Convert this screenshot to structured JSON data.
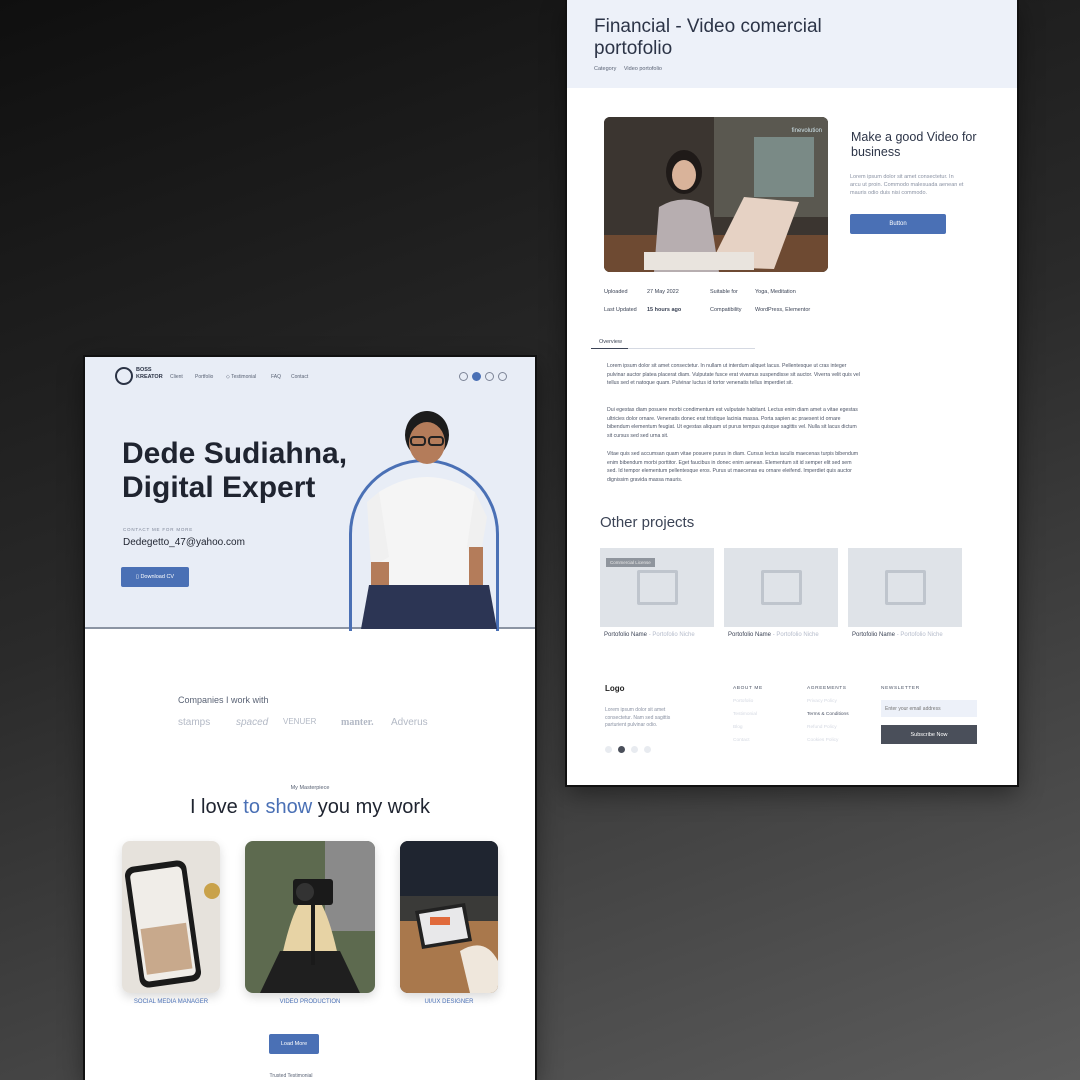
{
  "detail_page": {
    "title": "Financial - Video comercial portofolio",
    "breadcrumb": [
      "Category",
      "Video portofolio"
    ],
    "hero_brand": "finevolution",
    "side_title": "Make a good Video for business",
    "side_text": "Lorem ipsum dolor sit amet consectetur. In arcu ut proin. Commodo malesuada aenean et mauris odio duis nisi commodo.",
    "side_button": "Button",
    "meta": {
      "uploaded_label": "Uploaded",
      "uploaded_value": "27 May 2022",
      "suitable_label": "Suitable for",
      "suitable_value": "Yoga, Meditation",
      "updated_label": "Last Updated",
      "updated_value": "15 hours ago",
      "compat_label": "Compatibility",
      "compat_value": "WordPress, Elementor"
    },
    "tab": "Overview",
    "paragraphs": [
      "Lorem ipsum dolor sit amet consectetur. In nullam ut interdum aliquet lacus. Pellentesque ut cras integer pulvinar auctor platea placerat diam. Vulputate fusce erat vivamus suspendisse sit auctor. Viverra velit quis vel tellus sed et natoque quam. Pulvinar luctus id tortor venenatis tellus imperdiet sit.",
      "Dui egestas diam posuere morbi condimentum est vulputate habitant. Lectus enim diam amet a vitae egestas ultricies dolor ornare. Venenatis donec erat tristique lacinia massa. Porta sapien ac praesent id ornare bibendum elementum feugiat. Ut egestas aliquam ut purus tempus quisque sagittis vel. Nulla sit lacus dictum sit cursus sed sed urna sit.",
      "Vitae quis sed accumsan quam vitae posuere purus in diam. Cursus lectus iaculis maecenas turpis bibendum enim bibendum morbi porttitor. Eget faucibus in donec enim aenean. Elementum sit id semper elit sed sem sed. Id tempor elementum pellentesque eros. Purus ut maecenas eu ornare eleifend. Imperdiet quis auctor dignissim gravida massa mauris."
    ],
    "other_title": "Other projects",
    "card_tag": "Commercial License",
    "projects": [
      {
        "name": "Portofolio Name",
        "niche": "- Portofolio Niche"
      },
      {
        "name": "Portofolio Name",
        "niche": "- Portofolio Niche"
      },
      {
        "name": "Portofolio Name",
        "niche": "- Portofolio Niche"
      }
    ],
    "footer": {
      "logo": "Logo",
      "desc": "Lorem ipsum dolor sit amet consectetur. Nam sed sagittis parturient pulvinar odio.",
      "about_head": "ABOUT ME",
      "about_links": [
        "Portofolio",
        "Testimonial",
        "Blog",
        "Contact"
      ],
      "agreements_head": "AGREEMENTS",
      "agreement_links": [
        "Privacy Policy",
        "Terms & Conditions",
        "Refund Policy",
        "Cookies Policy"
      ],
      "newsletter_head": "NEWSLETTER",
      "email_placeholder": "Enter your email address",
      "subscribe": "Subscribe Now"
    }
  },
  "landing_page": {
    "logo_text": "BOSS KREATOR",
    "nav": [
      "Client",
      "Portfolio",
      "Testimonial",
      "FAQ",
      "Contact"
    ],
    "name": "Dede Sudiahna, Digital Expert",
    "contact_label": "CONTACT ME FOR MORE",
    "email": "Dedegetto_47@yahoo.com",
    "download_button": "Download CV",
    "companies_title": "Companies I work with",
    "companies": [
      "stamps",
      "spaced",
      "VENUER",
      "manter.",
      "Adverus"
    ],
    "masterpiece_label": "My Masterpiece",
    "headline_a": "I love ",
    "headline_b": "to show",
    "headline_c": " you my work",
    "works": [
      "SOCIAL MEDIA MANAGER",
      "VIDEO PRODUCTION",
      "UI/UX DESIGNER"
    ],
    "load_more": "Load More",
    "trusted": "Trusted Testimonial"
  },
  "colors": {
    "accent": "#4a70b5",
    "hero_bg": "#e8edf6",
    "text_dark": "#1f2430"
  }
}
